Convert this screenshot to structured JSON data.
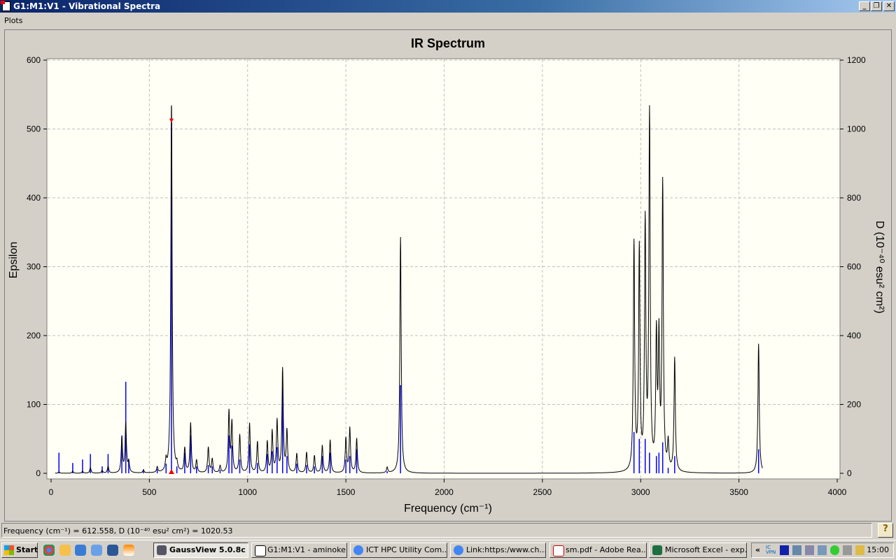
{
  "window": {
    "title": "G1:M1:V1 - Vibrational Spectra"
  },
  "menu": {
    "items": [
      "Plots"
    ]
  },
  "chart_data": {
    "type": "line",
    "title": "IR Spectrum",
    "xlabel": "Frequency (cm⁻¹)",
    "ylabel": "Epsilon",
    "y2label": "D (10⁻⁴⁰ esu² cm²)",
    "xlim": [
      0,
      4000
    ],
    "ylim": [
      0,
      600
    ],
    "y2lim": [
      0,
      1200
    ],
    "xticks": [
      "0",
      "500",
      "1000",
      "1500",
      "2000",
      "2500",
      "3000",
      "3500",
      "4000"
    ],
    "yticks": [
      "0",
      "100",
      "200",
      "300",
      "400",
      "500",
      "600"
    ],
    "y2ticks": [
      "0",
      "200",
      "400",
      "600",
      "800",
      "1000",
      "1200"
    ],
    "grid": true,
    "selected_frequency": 612.558,
    "series": [
      {
        "name": "spectrum",
        "color": "#000000"
      },
      {
        "name": "sticks",
        "color": "#0000ff"
      }
    ],
    "peaks": [
      {
        "freq": 40,
        "epsilon": 2,
        "stick": 30
      },
      {
        "freq": 110,
        "epsilon": 3,
        "stick": 15
      },
      {
        "freq": 160,
        "epsilon": 3,
        "stick": 20
      },
      {
        "freq": 200,
        "epsilon": 8,
        "stick": 28
      },
      {
        "freq": 260,
        "epsilon": 4,
        "stick": 10
      },
      {
        "freq": 290,
        "epsilon": 10,
        "stick": 28
      },
      {
        "freq": 360,
        "epsilon": 50,
        "stick": 55
      },
      {
        "freq": 380,
        "epsilon": 72,
        "stick": 133
      },
      {
        "freq": 395,
        "epsilon": 15,
        "stick": 18
      },
      {
        "freq": 470,
        "epsilon": 4,
        "stick": 6
      },
      {
        "freq": 540,
        "epsilon": 8,
        "stick": 6
      },
      {
        "freq": 585,
        "epsilon": 15,
        "stick": 14
      },
      {
        "freq": 612.558,
        "epsilon": 540,
        "stick": 510
      },
      {
        "freq": 640,
        "epsilon": 10,
        "stick": 10
      },
      {
        "freq": 680,
        "epsilon": 35,
        "stick": 30
      },
      {
        "freq": 710,
        "epsilon": 72,
        "stick": 55
      },
      {
        "freq": 740,
        "epsilon": 18,
        "stick": 10
      },
      {
        "freq": 800,
        "epsilon": 37,
        "stick": 12
      },
      {
        "freq": 820,
        "epsilon": 20,
        "stick": 10
      },
      {
        "freq": 860,
        "epsilon": 10,
        "stick": 5
      },
      {
        "freq": 905,
        "epsilon": 88,
        "stick": 55
      },
      {
        "freq": 920,
        "epsilon": 72,
        "stick": 40
      },
      {
        "freq": 960,
        "epsilon": 55,
        "stick": 20
      },
      {
        "freq": 1010,
        "epsilon": 72,
        "stick": 42
      },
      {
        "freq": 1050,
        "epsilon": 45,
        "stick": 15
      },
      {
        "freq": 1100,
        "epsilon": 45,
        "stick": 28
      },
      {
        "freq": 1125,
        "epsilon": 60,
        "stick": 32
      },
      {
        "freq": 1150,
        "epsilon": 75,
        "stick": 38
      },
      {
        "freq": 1178,
        "epsilon": 150,
        "stick": 125
      },
      {
        "freq": 1200,
        "epsilon": 60,
        "stick": 25
      },
      {
        "freq": 1250,
        "epsilon": 28,
        "stick": 14
      },
      {
        "freq": 1300,
        "epsilon": 30,
        "stick": 12
      },
      {
        "freq": 1340,
        "epsilon": 25,
        "stick": 10
      },
      {
        "freq": 1380,
        "epsilon": 40,
        "stick": 25
      },
      {
        "freq": 1420,
        "epsilon": 48,
        "stick": 30
      },
      {
        "freq": 1500,
        "epsilon": 50,
        "stick": 20
      },
      {
        "freq": 1520,
        "epsilon": 65,
        "stick": 25
      },
      {
        "freq": 1555,
        "epsilon": 50,
        "stick": 35
      },
      {
        "freq": 1710,
        "epsilon": 8,
        "stick": 3
      },
      {
        "freq": 1778,
        "epsilon": 343,
        "stick": 128
      },
      {
        "freq": 2966,
        "epsilon": 330,
        "stick": 60
      },
      {
        "freq": 2993,
        "epsilon": 320,
        "stick": 50
      },
      {
        "freq": 3023,
        "epsilon": 355,
        "stick": 50
      },
      {
        "freq": 3045,
        "epsilon": 515,
        "stick": 30
      },
      {
        "freq": 3080,
        "epsilon": 190,
        "stick": 25
      },
      {
        "freq": 3093,
        "epsilon": 185,
        "stick": 30
      },
      {
        "freq": 3112,
        "epsilon": 415,
        "stick": 45
      },
      {
        "freq": 3140,
        "epsilon": 40,
        "stick": 8
      },
      {
        "freq": 3173,
        "epsilon": 165,
        "stick": 25
      },
      {
        "freq": 3600,
        "epsilon": 188,
        "stick": 35
      }
    ]
  },
  "status": {
    "text": "Frequency (cm⁻¹) = 612.558, D (10⁻⁴⁰ esu² cm²) = 1020.53",
    "help": "?"
  },
  "taskbar": {
    "start": "Start",
    "tasks": [
      "GaussView 5.0.8c",
      "G1:M1:V1 - aminoke...",
      "ICT HPC Utility Com...",
      "Link:https:/www.ch....",
      "sm.pdf - Adobe Rea...",
      "Microsoft Excel - exp..."
    ],
    "tray_vpn": "IC VPN",
    "clock": "15:00"
  }
}
